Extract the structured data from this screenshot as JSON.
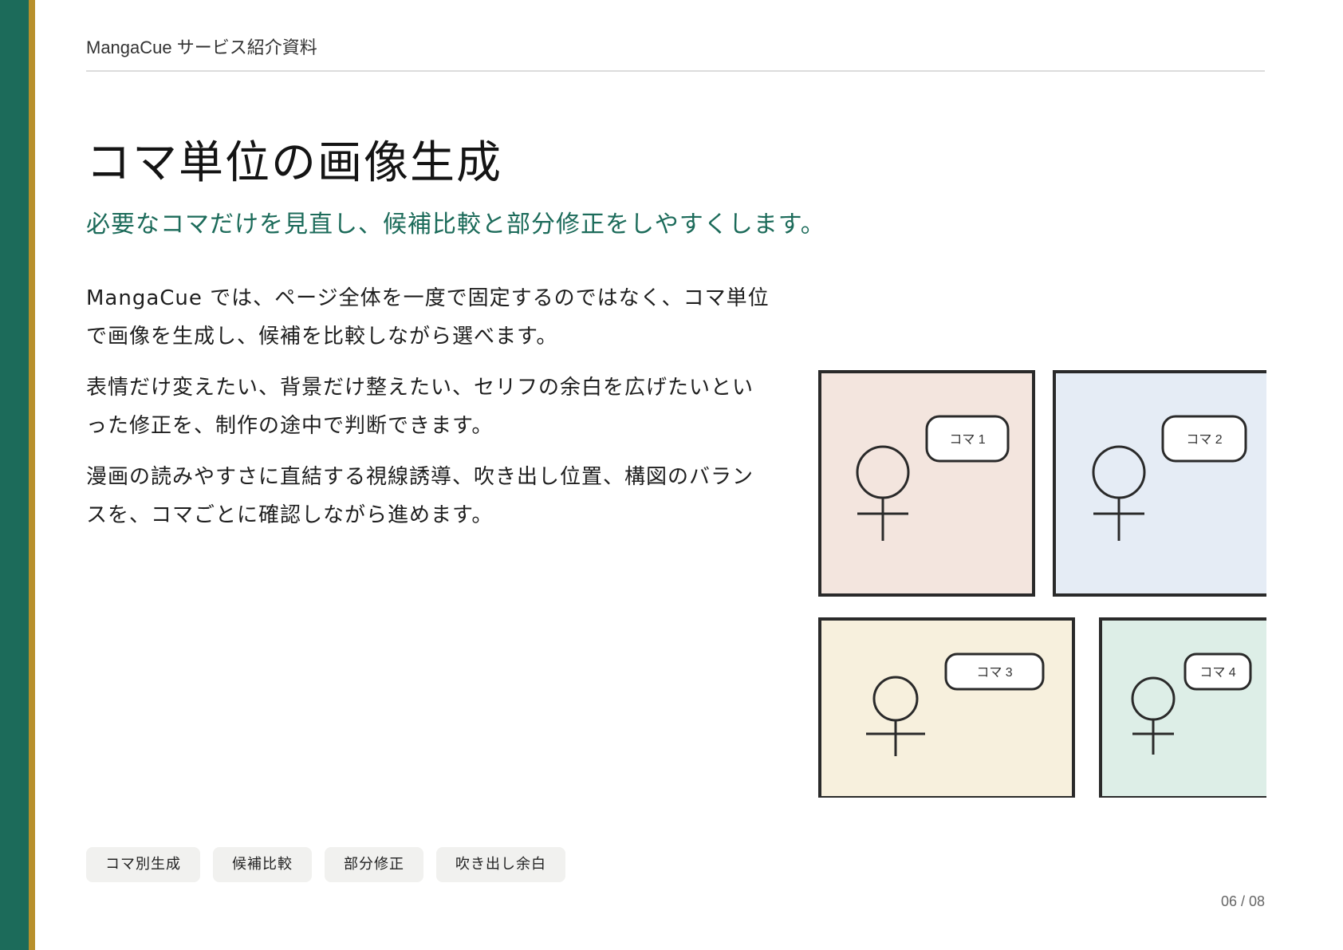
{
  "header": {
    "title": "MangaCue サービス紹介資料"
  },
  "slide": {
    "title": "コマ単位の画像生成",
    "subtitle": "必要なコマだけを見直し、候補比較と部分修正をしやすくします。",
    "paragraphs": [
      "MangaCue では、ページ全体を一度で固定するのではなく、コマ単位で画像を生成し、候補を比較しながら選べます。",
      "表情だけ変えたい、背景だけ整えたい、セリフの余白を広げたいといった修正を、制作の途中で判断できます。",
      "漫画の読みやすさに直結する視線誘導、吹き出し位置、構図のバランスを、コマごとに確認しながら進めます。"
    ]
  },
  "panels": [
    {
      "label": "コマ 1",
      "color": "#f3e5de"
    },
    {
      "label": "コマ 2",
      "color": "#e5ecf5"
    },
    {
      "label": "コマ 3",
      "color": "#f7f0dd"
    },
    {
      "label": "コマ 4",
      "color": "#ddeee7"
    }
  ],
  "tags": [
    "コマ別生成",
    "候補比較",
    "部分修正",
    "吹き出し余白"
  ],
  "page_number": "06 / 08",
  "colors": {
    "brand_green": "#1c6b5a",
    "accent_gold": "#b8902c",
    "panel_stroke": "#2a2a2a"
  }
}
